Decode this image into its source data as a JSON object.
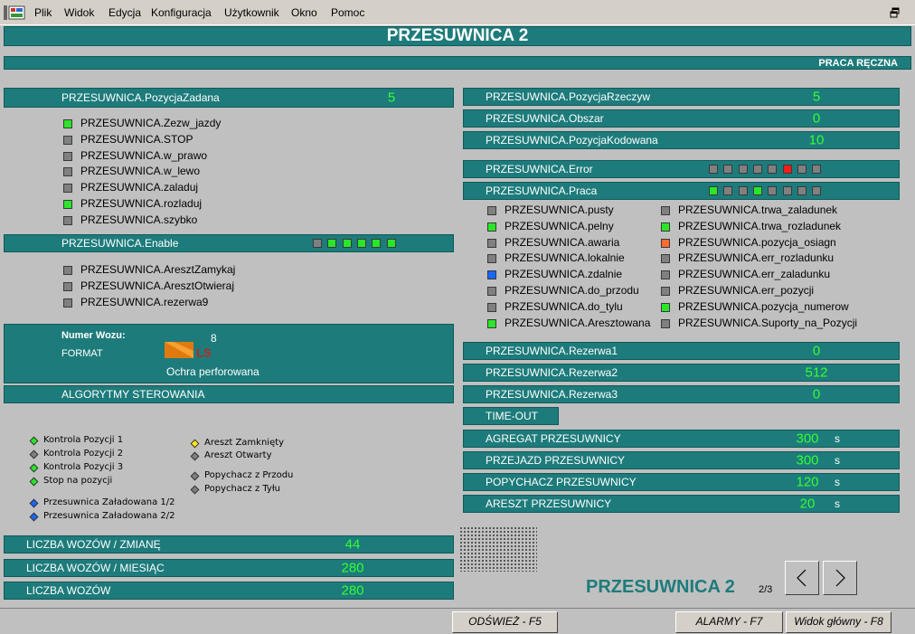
{
  "menu": {
    "items": [
      "Plik",
      "Widok",
      "Edycja",
      "Konfiguracja",
      "Użytkownik",
      "Okno",
      "Pomoc"
    ]
  },
  "header": {
    "title": "PRZESUWNICA 2",
    "mode": "PRACA RĘCZNA"
  },
  "left": {
    "pozycja_zadana": {
      "label": "PRZESUWNICA.PozycjaZadana",
      "value": "5"
    },
    "signals1": [
      {
        "label": "PRZESUWNICA.Zezw_jazdy",
        "color": "green"
      },
      {
        "label": "PRZESUWNICA.STOP",
        "color": "grey"
      },
      {
        "label": "PRZESUWNICA.w_prawo",
        "color": "grey"
      },
      {
        "label": "PRZESUWNICA.w_lewo",
        "color": "grey"
      },
      {
        "label": "PRZESUWNICA.zaladuj",
        "color": "grey"
      },
      {
        "label": "PRZESUWNICA.rozladuj",
        "color": "green"
      },
      {
        "label": "PRZESUWNICA.szybko",
        "color": "grey"
      }
    ],
    "enable": {
      "label": "PRZESUWNICA.Enable",
      "leds": [
        "grey",
        "green",
        "green",
        "green",
        "green",
        "green"
      ]
    },
    "signals2": [
      {
        "label": "PRZESUWNICA.AresztZamykaj",
        "color": "grey"
      },
      {
        "label": "PRZESUWNICA.AresztOtwieraj",
        "color": "grey"
      },
      {
        "label": "PRZESUWNICA.rezerwa9",
        "color": "grey"
      }
    ],
    "wagon": {
      "numer_label": "Numer Wozu:",
      "numer_value": "8",
      "format_label": "FORMAT",
      "format_code": "LS",
      "format_name": "Ochra perforowana"
    },
    "algo_title": "ALGORYTMY STEROWANIA",
    "algo_col1": [
      {
        "label": "Kontrola Pozycji 1",
        "color": "green"
      },
      {
        "label": "Kontrola Pozycji 2",
        "color": "grey"
      },
      {
        "label": "Kontrola Pozycji 3",
        "color": "green"
      },
      {
        "label": "Stop na pozycji",
        "color": "green"
      }
    ],
    "algo_col1b": [
      {
        "label": "Przesuwnica Załadowana 1/2",
        "color": "blue"
      },
      {
        "label": "Przesuwnica Załadowana 2/2",
        "color": "blue"
      }
    ],
    "algo_col2": [
      {
        "label": "Areszt Zamknięty",
        "color": "yellow"
      },
      {
        "label": "Areszt Otwarty",
        "color": "grey"
      }
    ],
    "algo_col2b": [
      {
        "label": "Popychacz z Przodu",
        "color": "grey"
      },
      {
        "label": "Popychacz z Tyłu",
        "color": "grey"
      }
    ],
    "counts": [
      {
        "label": "LICZBA WOZÓW / ZMIANĘ",
        "value": "44"
      },
      {
        "label": "LICZBA WOZÓW / MIESIĄC",
        "value": "280"
      },
      {
        "label": "LICZBA WOZÓW",
        "value": "280"
      }
    ]
  },
  "right": {
    "values": [
      {
        "label": "PRZESUWNICA.PozycjaRzeczyw",
        "value": "5"
      },
      {
        "label": "PRZESUWNICA.Obszar",
        "value": "0"
      },
      {
        "label": "PRZESUWNICA.PozycjaKodowana",
        "value": "10"
      }
    ],
    "error": {
      "label": "PRZESUWNICA.Error",
      "leds": [
        "grey",
        "grey",
        "grey",
        "grey",
        "grey",
        "red",
        "grey",
        "grey"
      ]
    },
    "praca": {
      "label": "PRZESUWNICA.Praca",
      "leds": [
        "green",
        "grey",
        "grey",
        "green",
        "grey",
        "grey",
        "grey",
        "grey"
      ]
    },
    "status_col1": [
      {
        "label": "PRZESUWNICA.pusty",
        "color": "grey"
      },
      {
        "label": "PRZESUWNICA.pelny",
        "color": "green"
      },
      {
        "label": "PRZESUWNICA.awaria",
        "color": "grey"
      },
      {
        "label": "PRZESUWNICA.lokalnie",
        "color": "grey"
      },
      {
        "label": "PRZESUWNICA.zdalnie",
        "color": "blue"
      },
      {
        "label": "PRZESUWNICA.do_przodu",
        "color": "grey"
      },
      {
        "label": "PRZESUWNICA.do_tylu",
        "color": "grey"
      },
      {
        "label": "PRZESUWNICA.Aresztowana",
        "color": "green"
      }
    ],
    "status_col2": [
      {
        "label": "PRZESUWNICA.trwa_zaladunek",
        "color": "grey"
      },
      {
        "label": "PRZESUWNICA.trwa_rozladunek",
        "color": "green"
      },
      {
        "label": "PRZESUWNICA.pozycja_osiagn",
        "color": "orange"
      },
      {
        "label": "PRZESUWNICA.err_rozladunku",
        "color": "grey"
      },
      {
        "label": "PRZESUWNICA.err_zaladunku",
        "color": "grey"
      },
      {
        "label": "PRZESUWNICA.err_pozycji",
        "color": "grey"
      },
      {
        "label": "PRZESUWNICA.pozycja_numerow",
        "color": "green"
      },
      {
        "label": "PRZESUWNICA.Suporty_na_Pozycji",
        "color": "grey"
      }
    ],
    "rezerwy": [
      {
        "label": "PRZESUWNICA.Rezerwa1",
        "value": "0"
      },
      {
        "label": "PRZESUWNICA.Rezerwa2",
        "value": "512"
      },
      {
        "label": "PRZESUWNICA.Rezerwa3",
        "value": "0"
      }
    ],
    "timeout_title": "TIME-OUT",
    "timeouts": [
      {
        "label": "AGREGAT PRZESUWNICY",
        "value": "300",
        "unit": "s"
      },
      {
        "label": "PRZEJAZD PRZESUWNICY",
        "value": "300",
        "unit": "s"
      },
      {
        "label": "POPYCHACZ PRZESUWNICY",
        "value": "120",
        "unit": "s"
      },
      {
        "label": "ARESZT PRZESUWNICY",
        "value": "20",
        "unit": "s"
      }
    ],
    "footer_title": "PRZESUWNICA 2",
    "page": "2/3"
  },
  "buttons": {
    "refresh": "ODŚWIEŻ - F5",
    "alarms": "ALARMY - F7",
    "main": "Widok główny - F8"
  },
  "colors": {
    "green": "#29e629",
    "grey": "#808080",
    "red": "#ff1a1a",
    "blue": "#1a66ff",
    "orange": "#ff6a33",
    "yellow": "#ffe61a",
    "teal": "#1e7b7b",
    "value": "#33ff33"
  }
}
